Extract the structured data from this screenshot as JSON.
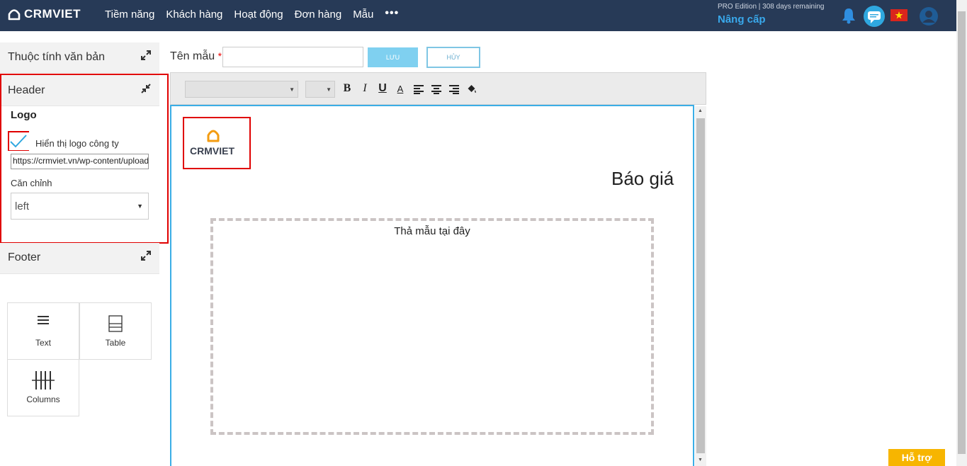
{
  "app": {
    "brand": "CRMVIET",
    "nav": [
      "Tiềm năng",
      "Khách hàng",
      "Hoạt động",
      "Đơn hàng",
      "Mẫu"
    ],
    "nav_more": "•••",
    "edition": "PRO Edition | 308 days remaining",
    "upgrade": "Nâng cấp"
  },
  "sidebar": {
    "section_properties": "Thuộc tính văn bản",
    "section_header": "Header",
    "logo_heading": "Logo",
    "show_logo_label": "Hiển thị logo công ty",
    "show_logo_checked": true,
    "logo_url": "https://crmviet.vn/wp-content/uploads",
    "align_label": "Căn chỉnh",
    "align_value": "left",
    "section_footer": "Footer",
    "blocks": [
      "Text",
      "Table",
      "Columns"
    ]
  },
  "form": {
    "name_label": "Tên mẫu",
    "required_mark": "*",
    "name_value": "",
    "save_label": "LƯU",
    "cancel_label": "HỦY"
  },
  "toolbar": {
    "bold": "B",
    "italic": "I",
    "underline": "U",
    "font_color": "A"
  },
  "document": {
    "logo_text": "CRMVIET",
    "title": "Báo giá",
    "drop_text": "Thả mẫu tại đây"
  },
  "support_label": "Hỗ trợ",
  "colors": {
    "nav_bg": "#273a57",
    "accent": "#39a9ec",
    "highlight": "#e00000",
    "support": "#f7b500",
    "logo_orange": "#f39c12"
  }
}
